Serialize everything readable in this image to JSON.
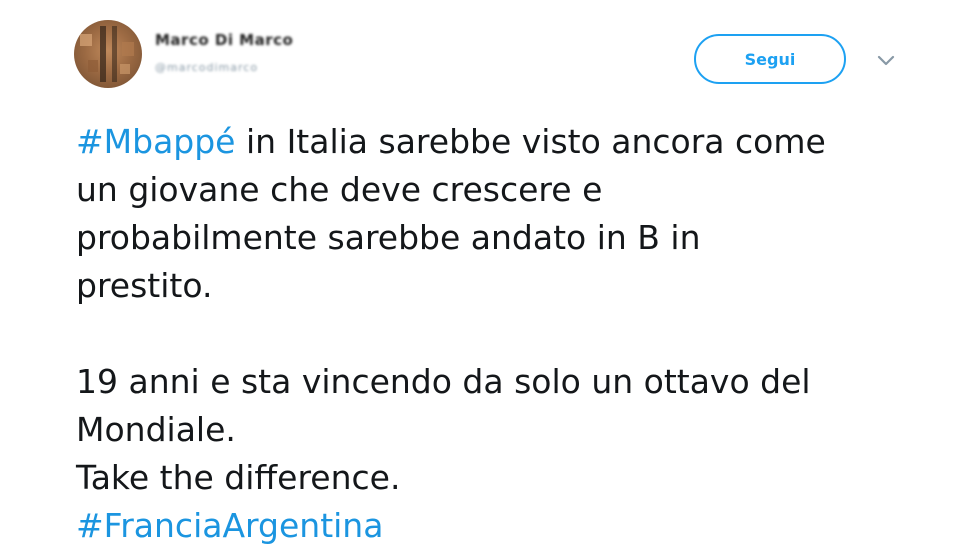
{
  "user": {
    "display_name": "Marco Di Marco",
    "handle": "@marcodimarco"
  },
  "follow_button": {
    "label": "Segui"
  },
  "caret": {
    "icon": "chevron-down-icon"
  },
  "tweet": {
    "hashtag_1": "#Mbappé",
    "line_1_rest": " in Italia sarebbe visto ancora come",
    "line_2": "un giovane che deve crescere e",
    "line_3": "probabilmente sarebbe andato in B in",
    "line_4": "prestito.",
    "line_5": "19 anni e sta vincendo da solo un ottavo del",
    "line_6": "Mondiale.",
    "line_7": "Take the difference.",
    "hashtag_2": "#FranciaArgentina"
  },
  "colors": {
    "accent": "#1da1f2",
    "hashtag": "#1b95e0",
    "text": "#14171a",
    "muted": "#8899a6"
  }
}
